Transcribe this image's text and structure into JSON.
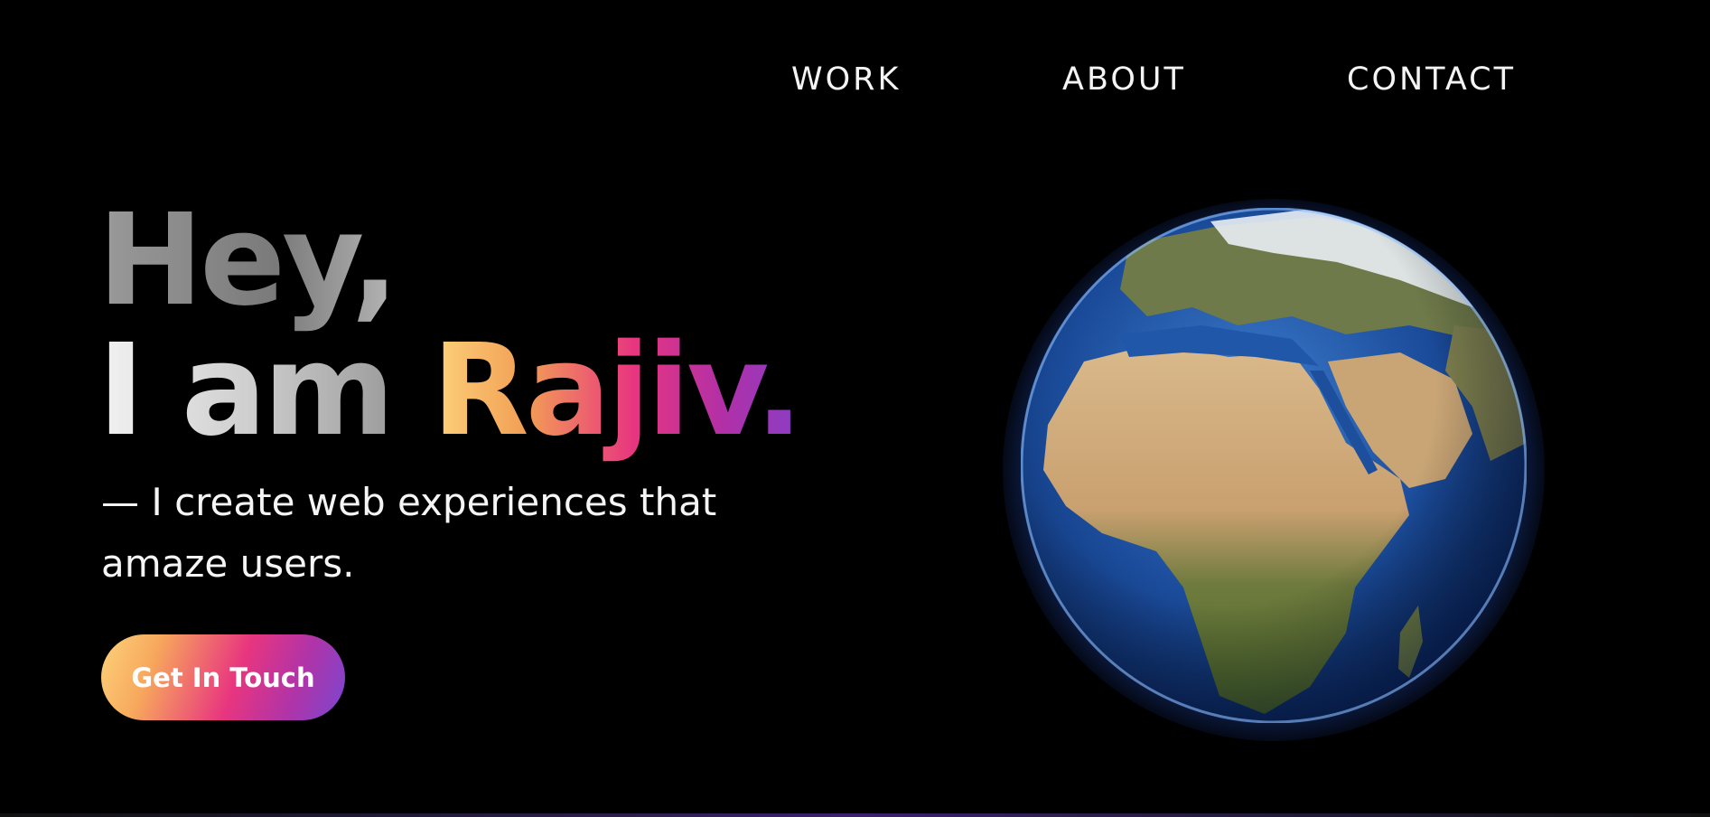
{
  "nav": {
    "items": [
      {
        "label": "WORK"
      },
      {
        "label": "ABOUT"
      },
      {
        "label": "CONTACT"
      }
    ]
  },
  "hero": {
    "line1": "Hey,",
    "line2_prefix": "I am ",
    "line2_name": "Rajiv."
  },
  "tagline": "— I create web experiences that amaze users.",
  "cta": {
    "label": "Get In Touch"
  },
  "colors": {
    "background": "#000000",
    "gradient_start": "#fdd27a",
    "gradient_mid": "#e8357f",
    "gradient_end": "#8a3ec6",
    "globe_glow": "#508cff"
  },
  "icons": {
    "globe": "earth-globe-icon"
  }
}
